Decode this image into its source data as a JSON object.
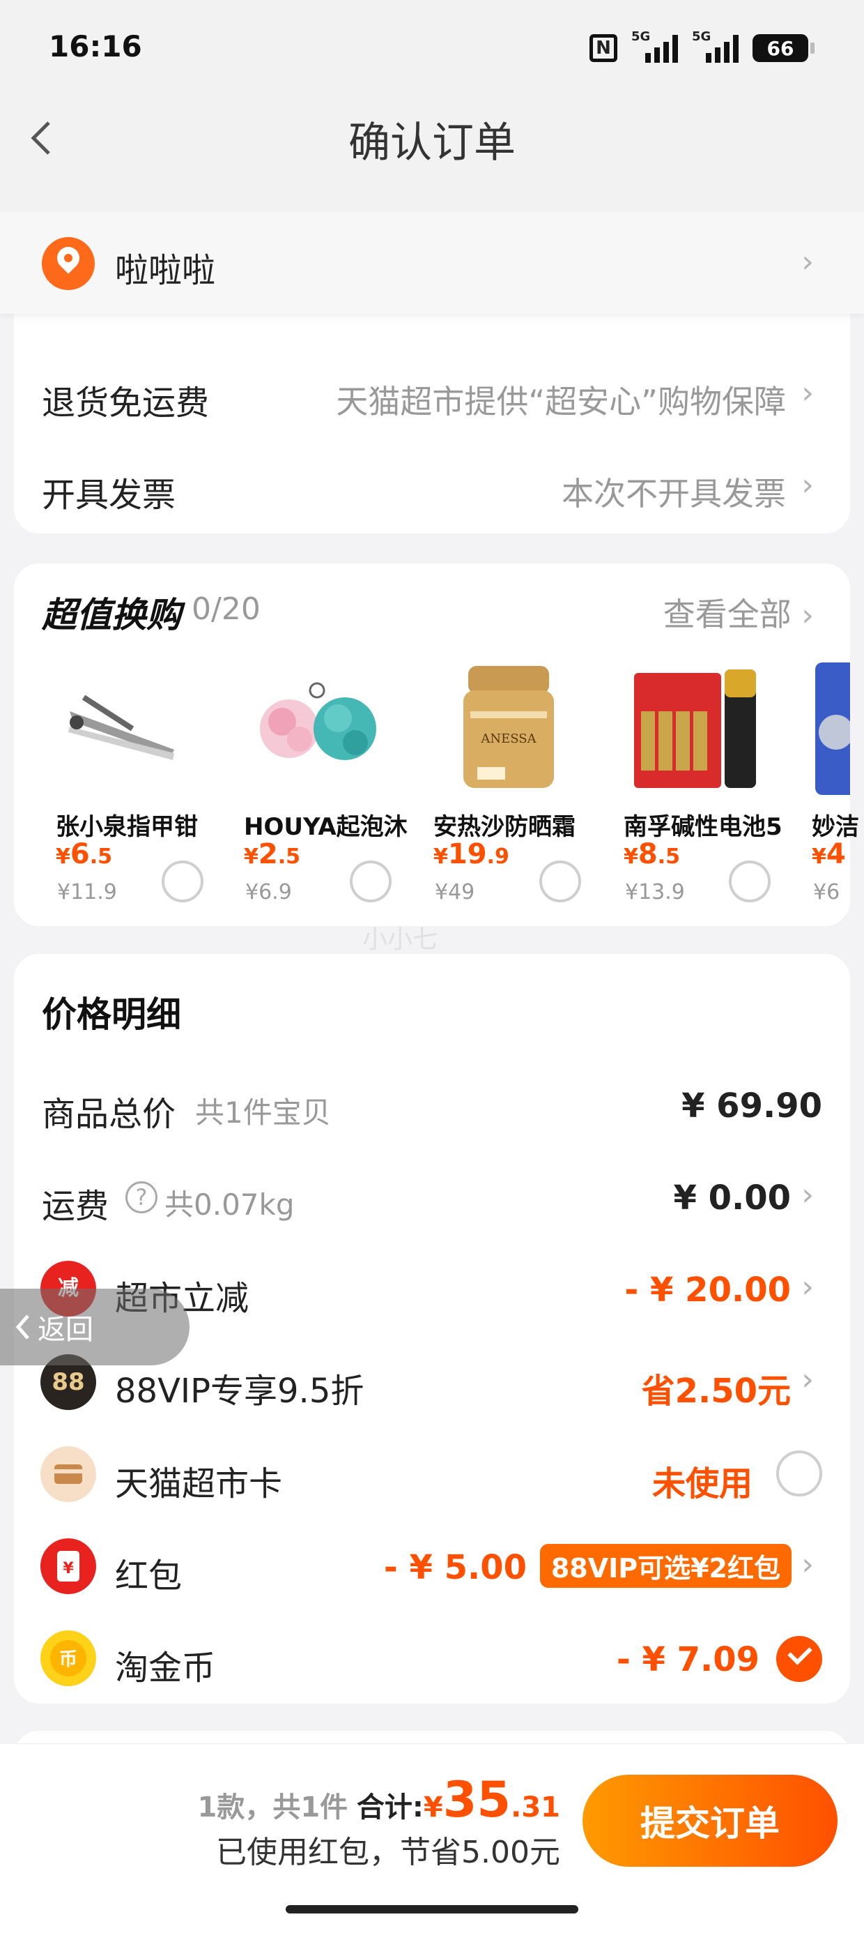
{
  "status_bar": {
    "time": "16:16",
    "battery": "66",
    "nfc": "N",
    "signal1": "5G",
    "signal2": "5G"
  },
  "nav": {
    "title": "确认订单"
  },
  "address": {
    "name": "啦啦啦"
  },
  "service_rows": [
    {
      "label": "退货免运费",
      "value": "天猫超市提供“超安心”购物保障"
    },
    {
      "label": "开具发票",
      "value": "本次不开具发票"
    }
  ],
  "swap": {
    "title": "超值换购",
    "count": "0/20",
    "view_all": "查看全部",
    "products": [
      {
        "name": "张小泉指甲钳",
        "price_int": "6",
        "price_dec": ".5",
        "original": "¥11.9",
        "image": "nail-clipper"
      },
      {
        "name": "HOUYA起泡沐",
        "price_int": "2",
        "price_dec": ".5",
        "original": "¥6.9",
        "image": "bath-puff"
      },
      {
        "name": "安热沙防晒霜",
        "price_int": "19",
        "price_dec": ".9",
        "original": "¥49",
        "image": "sunscreen"
      },
      {
        "name": "南孚碱性电池5",
        "price_int": "8",
        "price_dec": ".5",
        "original": "¥13.9",
        "image": "batteries"
      },
      {
        "name": "妙洁",
        "price_int": "4",
        "price_dec": "",
        "original": "¥6",
        "image": "cleaning-ball"
      }
    ],
    "currency": "¥"
  },
  "watermark": "小小七",
  "price_detail": {
    "title": "价格明细",
    "goods_total": {
      "label": "商品总价",
      "sub": "共1件宝贝",
      "value": "¥ 69.90"
    },
    "shipping": {
      "label": "运费",
      "sub": "共0.07kg",
      "value": "¥ 0.00"
    },
    "discount": {
      "label": "超市立减",
      "icon_text": "减",
      "value": "- ¥ 20.00"
    },
    "vip": {
      "label": "88VIP专享9.5折",
      "icon_text": "88",
      "value": "省2.50元"
    },
    "card": {
      "label": "天猫超市卡",
      "value": "未使用"
    },
    "red_packet": {
      "label": "红包",
      "icon_text": "¥",
      "value": "- ¥ 5.00",
      "badge": "88VIP可选¥2红包"
    },
    "coins": {
      "label": "淘金币",
      "icon_text": "币",
      "value": "- ¥ 7.09"
    }
  },
  "floating_back": "返回",
  "footer": {
    "count": "1款，共1件",
    "sum_label": "合计:",
    "currency": "¥",
    "total_int": "35",
    "total_dec": ".31",
    "saved": "已使用红包，节省5.00元",
    "submit": "提交订单"
  },
  "colors": {
    "accent": "#ff5000",
    "accent_gradient_start": "#ff9a00"
  }
}
